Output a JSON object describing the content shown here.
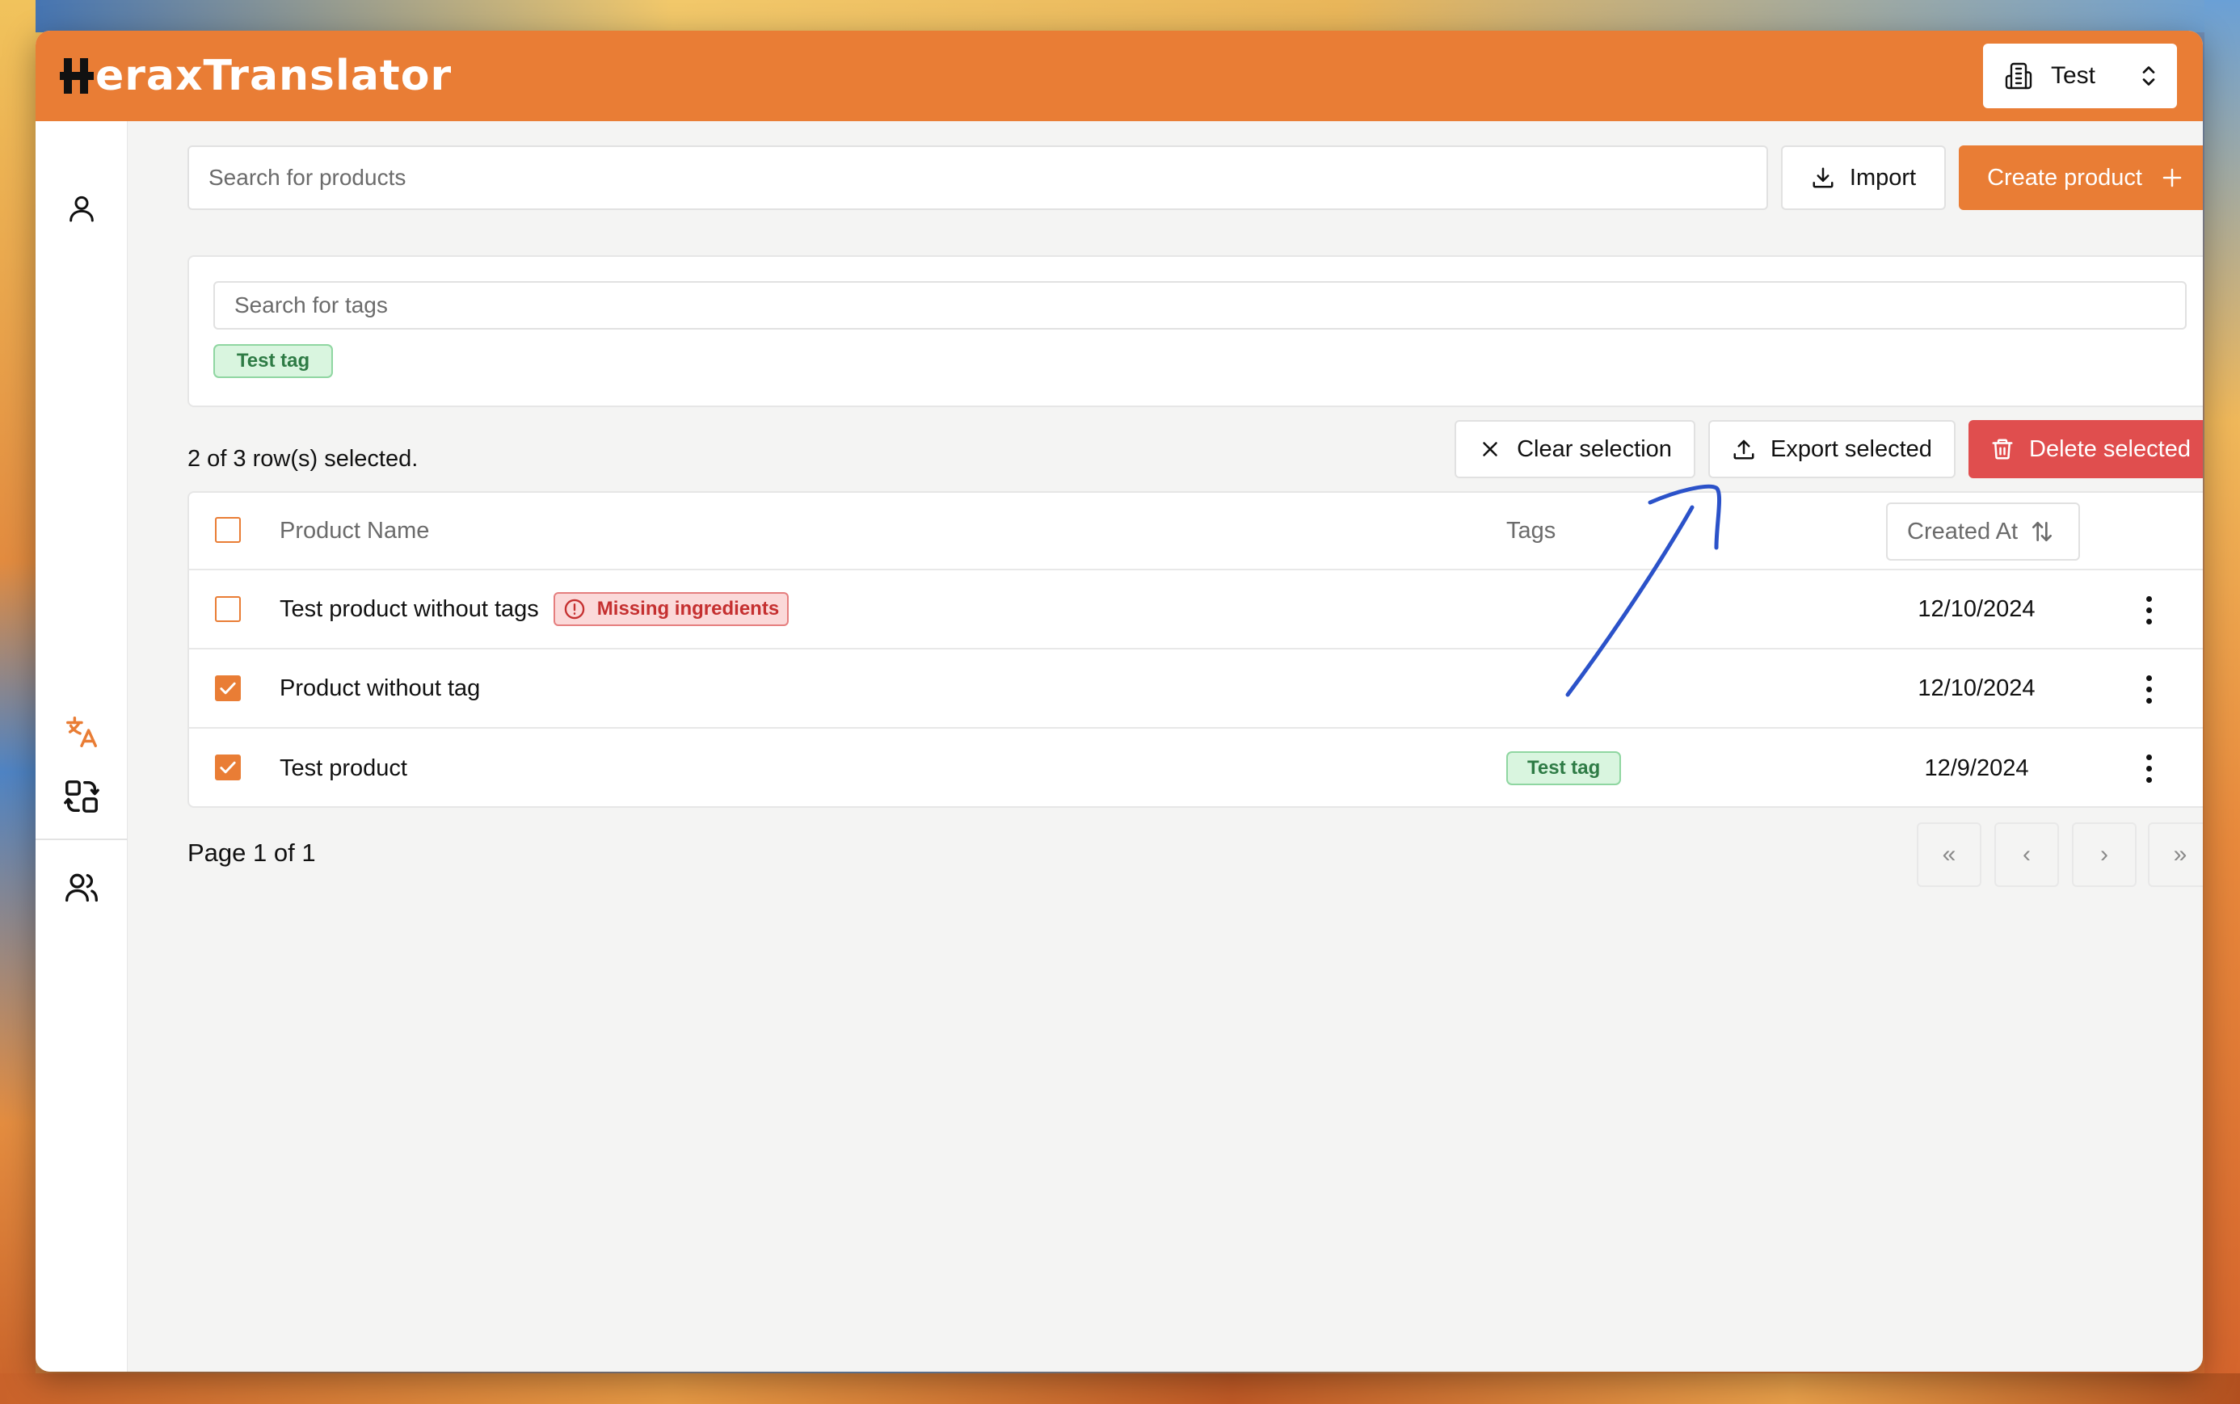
{
  "app": {
    "logo_text": "eraxTranslator",
    "org_selector": "Test"
  },
  "search": {
    "products_placeholder": "Search for products",
    "tags_placeholder": "Search for tags"
  },
  "toolbar": {
    "import_label": "Import",
    "create_label": "Create product"
  },
  "tag_filter": {
    "chips": [
      "Test tag"
    ]
  },
  "selection": {
    "status": "2 of 3 row(s) selected.",
    "clear_label": "Clear selection",
    "export_label": "Export selected",
    "delete_label": "Delete selected"
  },
  "table": {
    "headers": {
      "name": "Product Name",
      "tags": "Tags",
      "created": "Created At"
    },
    "rows": [
      {
        "name": "Test product without tags",
        "warning": "Missing ingredients",
        "tag": "",
        "created": "12/10/2024",
        "selected": false
      },
      {
        "name": "Product without tag",
        "warning": "",
        "tag": "",
        "created": "12/10/2024",
        "selected": true
      },
      {
        "name": "Test product",
        "warning": "",
        "tag": "Test tag",
        "created": "12/9/2024",
        "selected": true
      }
    ]
  },
  "pagination": {
    "label": "Page 1 of 1",
    "first": "«",
    "prev": "‹",
    "next": "›",
    "last": "»"
  },
  "colors": {
    "accent": "#e97d35",
    "danger": "#e04e4e",
    "tag_bg": "#d9f5df",
    "annotation": "#2b52c9"
  }
}
